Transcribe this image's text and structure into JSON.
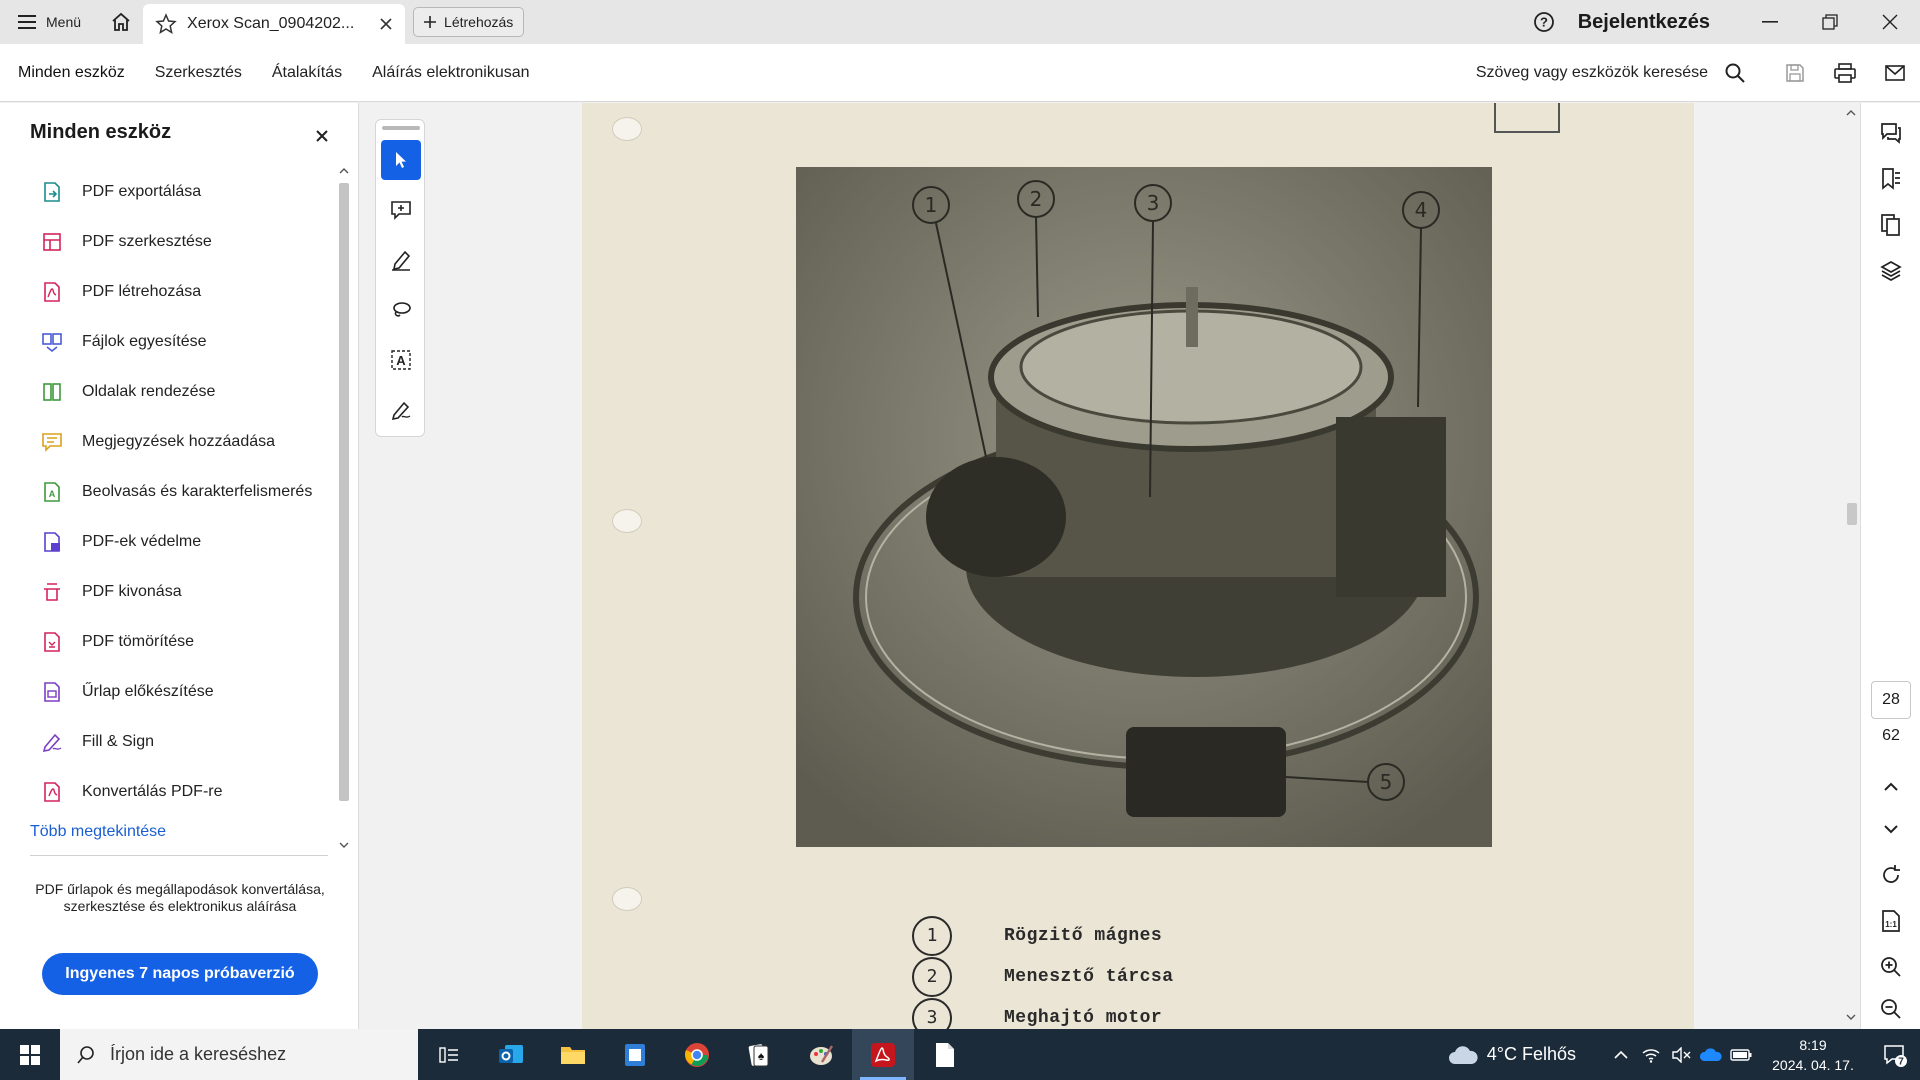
{
  "titlebar": {
    "menu_label": "Menü",
    "tab_title": "Xerox Scan_0904202...",
    "create_label": "Létrehozás",
    "signin_label": "Bejelentkezés"
  },
  "menubar": {
    "items": [
      "Minden eszköz",
      "Szerkesztés",
      "Átalakítás",
      "Aláírás elektronikusan"
    ],
    "search_label": "Szöveg vagy eszközök keresése"
  },
  "left_panel": {
    "title": "Minden eszköz",
    "tools": [
      {
        "label": "PDF exportálása",
        "icon": "export-pdf-icon",
        "color": "#1b8c8c"
      },
      {
        "label": "PDF szerkesztése",
        "icon": "edit-pdf-icon",
        "color": "#d3245b"
      },
      {
        "label": "PDF létrehozása",
        "icon": "create-pdf-icon",
        "color": "#d3245b"
      },
      {
        "label": "Fájlok egyesítése",
        "icon": "combine-files-icon",
        "color": "#4b5bd6"
      },
      {
        "label": "Oldalak rendezése",
        "icon": "organize-pages-icon",
        "color": "#3c9a3c"
      },
      {
        "label": "Megjegyzések hozzáadása",
        "icon": "comment-icon",
        "color": "#d9a21b"
      },
      {
        "label": "Beolvasás és karakterfelismerés",
        "icon": "scan-ocr-icon",
        "color": "#3c9a3c"
      },
      {
        "label": "PDF-ek védelme",
        "icon": "protect-pdf-icon",
        "color": "#5a3fd0"
      },
      {
        "label": "PDF kivonása",
        "icon": "redact-pdf-icon",
        "color": "#d3245b"
      },
      {
        "label": "PDF tömörítése",
        "icon": "compress-pdf-icon",
        "color": "#d3245b"
      },
      {
        "label": "Űrlap előkészítése",
        "icon": "prepare-form-icon",
        "color": "#7b3fc4"
      },
      {
        "label": "Fill & Sign",
        "icon": "fill-sign-icon",
        "color": "#7b3fc4"
      },
      {
        "label": "Konvertálás PDF-re",
        "icon": "convert-pdf-icon",
        "color": "#d3245b"
      }
    ],
    "more_link": "Több megtekintése",
    "promo_text": "PDF űrlapok és megállapodások konvertálása, szerkesztése és elektronikus aláírása",
    "trial_button": "Ingyenes 7 napos próbaverzió"
  },
  "document": {
    "photo_callouts": [
      "1",
      "2",
      "3",
      "4",
      "5"
    ],
    "legend": [
      {
        "num": "1",
        "text": "Rögzitő mágnes"
      },
      {
        "num": "2",
        "text": "Menesztő tárcsa"
      },
      {
        "num": "3",
        "text": "Meghajtó motor"
      }
    ]
  },
  "right_rail": {
    "current_page": "28",
    "total_pages": "62"
  },
  "taskbar": {
    "search_placeholder": "Írjon ide a kereséshez",
    "weather": "4°C  Felhős",
    "time": "8:19",
    "date": "2024. 04. 17.",
    "notifications": "7"
  },
  "colors": {
    "accent": "#1461e6",
    "taskbar": "#1c2b3a",
    "page_paper": "#ebe5d5"
  }
}
